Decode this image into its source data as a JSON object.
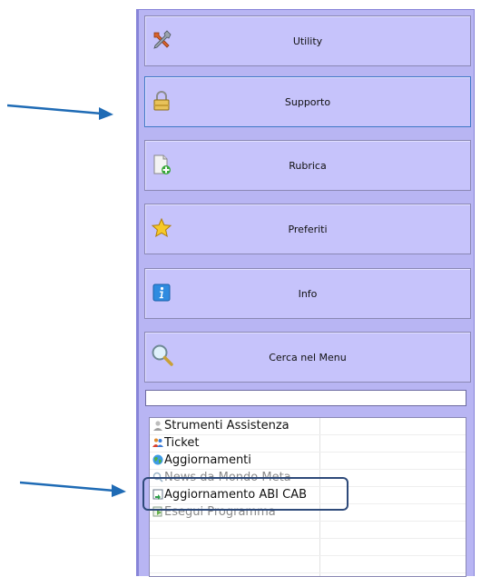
{
  "menu": {
    "items": [
      {
        "label": "Utility",
        "icon": "tools-icon"
      },
      {
        "label": "Supporto",
        "icon": "padlock-icon",
        "selected": true
      },
      {
        "label": "Rubrica",
        "icon": "new-document-icon"
      },
      {
        "label": "Preferiti",
        "icon": "star-icon"
      },
      {
        "label": "Info",
        "icon": "info-icon"
      },
      {
        "label": "Cerca nel Menu",
        "icon": "magnifier-icon"
      }
    ]
  },
  "search": {
    "value": ""
  },
  "list": {
    "items": [
      {
        "label": "Strumenti Assistenza",
        "icon": "support-person-icon"
      },
      {
        "label": "Ticket",
        "icon": "people-icon"
      },
      {
        "label": "Aggiornamenti",
        "icon": "globe-icon"
      },
      {
        "label": "News da Mondo Meta",
        "icon": "news-icon"
      },
      {
        "label": "Aggiornamento ABI CAB",
        "icon": "update-icon"
      },
      {
        "label": "Esegui Programma",
        "icon": "run-icon"
      }
    ]
  },
  "colors": {
    "panel_bg": "#b8b5f3",
    "button_bg": "#c6c3fb",
    "selected_border": "#3f78c6",
    "annotation_arrow": "#1f6bb5",
    "highlight_box": "#2e4a7a"
  }
}
